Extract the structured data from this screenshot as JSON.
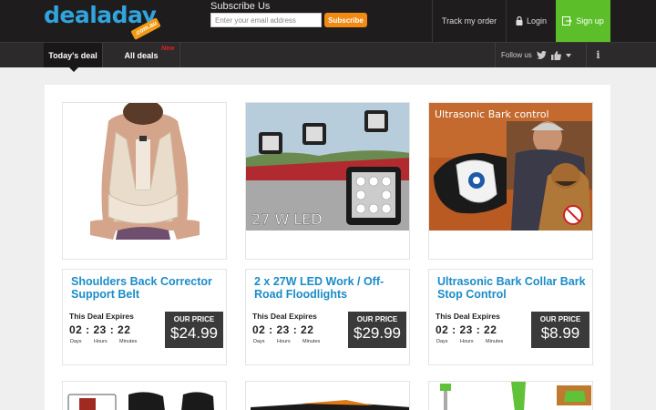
{
  "header": {
    "logo_text": "dealaday",
    "logo_tag": ".com.au",
    "subscribe_title": "Subscribe Us",
    "subscribe_placeholder": "Enter your email address",
    "subscribe_button": "Subscribe",
    "track_order": "Track my order",
    "login": "Login",
    "signup": "Sign up"
  },
  "nav": {
    "tab_today": "Today's deal",
    "tab_all": "All deals",
    "new_badge": "New",
    "follow_us": "Follow us",
    "info": "i"
  },
  "deals": [
    {
      "title": "Shoulders Back Corrector Support Belt",
      "expires_label": "This Deal Expires",
      "timer": "02 : 23 : 22",
      "timer_days": "Days",
      "timer_hours": "Hours",
      "timer_minutes": "Minutes",
      "price_label": "OUR PRICE",
      "price": "$24.99"
    },
    {
      "title": "2 x 27W LED Work / Off-Road Floodlights",
      "image_text": "27 W LED",
      "expires_label": "This Deal Expires",
      "timer": "02 : 23 : 22",
      "timer_days": "Days",
      "timer_hours": "Hours",
      "timer_minutes": "Minutes",
      "price_label": "OUR PRICE",
      "price": "$29.99"
    },
    {
      "title": "Ultrasonic Bark Collar Bark Stop Control",
      "image_text": "Ultrasonic Bark control",
      "expires_label": "This Deal Expires",
      "timer": "02 : 23 : 22",
      "timer_days": "Days",
      "timer_hours": "Hours",
      "timer_minutes": "Minutes",
      "price_label": "OUR PRICE",
      "price": "$8.99"
    }
  ],
  "colors": {
    "header_bg": "#1f1c1d",
    "brand_blue": "#2fa4de",
    "subscribe_orange": "#f08a12",
    "signup_green": "#5cbf2a",
    "title_blue": "#1a8cc8",
    "price_box": "#3a3a3a"
  }
}
